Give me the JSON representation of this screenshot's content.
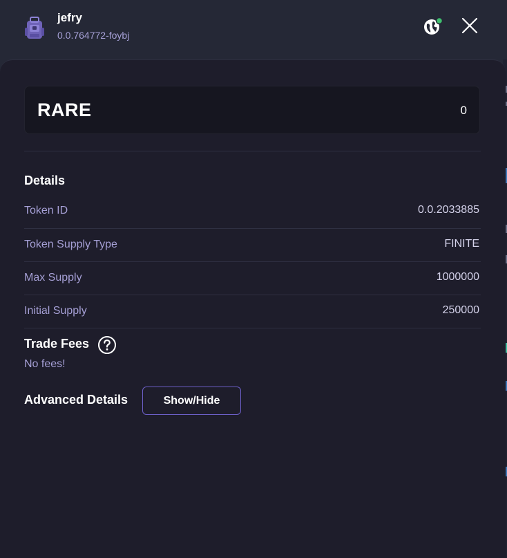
{
  "header": {
    "account_name": "jefry",
    "account_id": "0.0.764772-foybj",
    "avatar_icon": "backpack-icon",
    "network_icon": "globe-icon",
    "network_status_color": "#3fbf6f",
    "close_icon": "close-icon"
  },
  "token": {
    "symbol": "RARE",
    "balance": "0"
  },
  "details": {
    "title": "Details",
    "rows": [
      {
        "label": "Token ID",
        "value": "0.0.2033885"
      },
      {
        "label": "Token Supply Type",
        "value": "FINITE"
      },
      {
        "label": "Max Supply",
        "value": "1000000"
      },
      {
        "label": "Initial Supply",
        "value": "250000"
      }
    ]
  },
  "trade_fees": {
    "title": "Trade Fees",
    "help_icon": "question-circle-icon",
    "empty_text": "No fees!"
  },
  "advanced": {
    "title": "Advanced Details",
    "toggle_label": "Show/Hide"
  },
  "colors": {
    "accent": "#6c5fc7",
    "label": "#a6a0d6",
    "panel_bg": "#1e1d2b",
    "header_bg": "#252836"
  }
}
